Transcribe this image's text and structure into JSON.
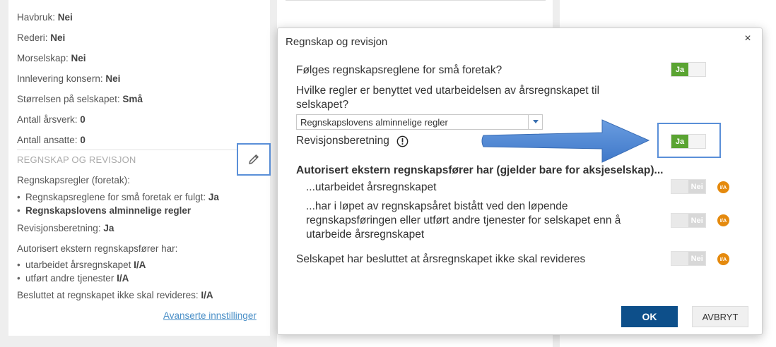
{
  "left_panel": {
    "rows": [
      {
        "label": "Havbruk:",
        "value": "Nei"
      },
      {
        "label": "Rederi:",
        "value": "Nei"
      },
      {
        "label": "Morselskap:",
        "value": "Nei"
      },
      {
        "label": "Innlevering konsern:",
        "value": "Nei"
      },
      {
        "label": "Størrelsen på selskapet:",
        "value": "Små"
      },
      {
        "label": "Antall årsverk:",
        "value": "0"
      },
      {
        "label": "Antall ansatte:",
        "value": "0"
      }
    ],
    "section_title": "REGNSKAP OG REVISJON",
    "regnskapsregler_label": "Regnskapsregler (foretak):",
    "bullet1_text": "Regnskapsreglene for små foretak er fulgt:",
    "bullet1_value": "Ja",
    "bullet2_value": "Regnskapslovens alminnelige regler",
    "revisjon_label": "Revisjonsberetning:",
    "revisjon_value": "Ja",
    "autorisert_label": "Autorisert ekstern regnskapsfører har:",
    "bullet3_text": "utarbeidet årsregnskapet",
    "bullet3_value": "I/A",
    "bullet4_text": "utført andre tjenester",
    "bullet4_value": "I/A",
    "besluttet_label": "Besluttet at regnskapet ikke skal revideres:",
    "besluttet_value": "I/A",
    "advanced_link": "Avanserte innstillinger"
  },
  "modal": {
    "title": "Regnskap og revisjon",
    "close_glyph": "×",
    "q1": "Følges regnskapsreglene for små foretak?",
    "q2": "Hvilke regler er benyttet ved utarbeidelsen av årsregnskapet til selskapet?",
    "select_value": "Regnskapslovens alminnelige regler",
    "q3": "Revisjonsberetning",
    "q4": "Autorisert ekstern regnskapsfører har (gjelder bare for aksjeselskap)...",
    "q4a": "...utarbeidet årsregnskapet",
    "q4b": "...har i løpet av regnskapsåret bistått ved den løpende regnskapsføringen eller utført andre tjenester for selskapet enn å utarbeide årsregnskapet",
    "q5": "Selskapet har besluttet at årsregnskapet ikke skal revideres",
    "toggle_yes": "Ja",
    "toggle_no": "Nei",
    "ia_badge": "I/A",
    "ok_label": "OK",
    "cancel_label": "AVBRYT"
  },
  "colors": {
    "toggle_on": "#5aa432",
    "ok_button": "#0d4f8a",
    "highlight": "#5a8fd8",
    "ia_badge": "#e58a0e"
  }
}
